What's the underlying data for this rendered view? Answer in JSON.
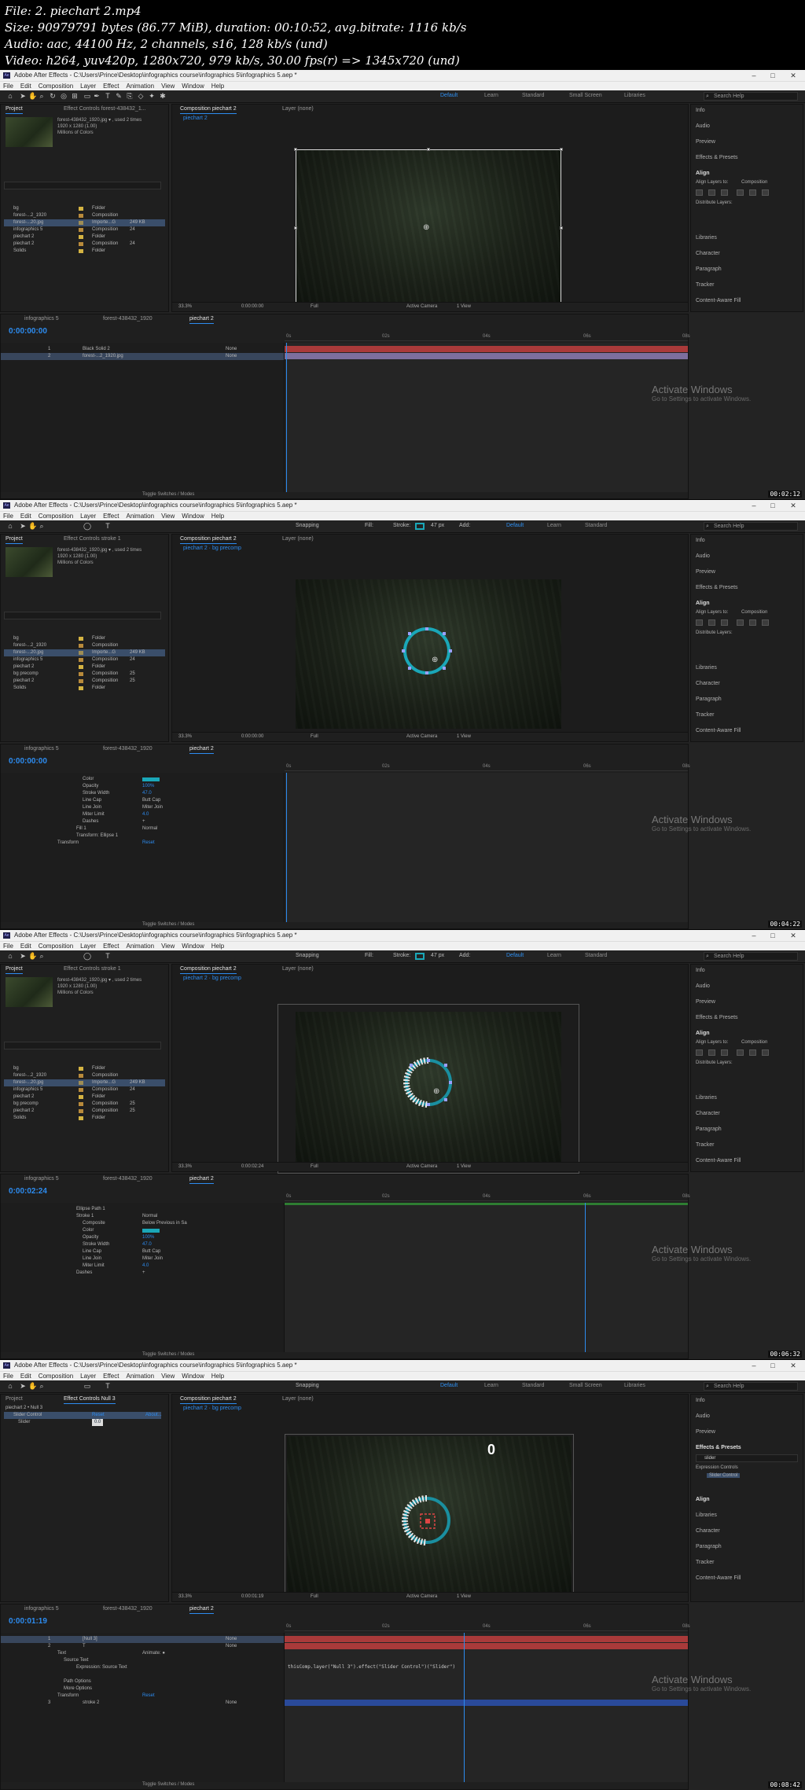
{
  "header": {
    "file": "File: 2. piechart 2.mp4",
    "size": "Size: 90979791 bytes (86.77 MiB), duration: 00:10:52, avg.bitrate: 1116 kb/s",
    "audio": "Audio: aac, 44100 Hz, 2 channels, s16, 128 kb/s (und)",
    "video": "Video: h264, yuv420p, 1280x720, 979 kb/s, 30.00 fps(r) => 1345x720 (und)"
  },
  "app": {
    "title_1": "Adobe After Effects - C:\\Users\\Prince\\Desktop\\infographics course\\infographics 5\\infographics 5.aep *",
    "menu": [
      "File",
      "Edit",
      "Composition",
      "Layer",
      "Effect",
      "Animation",
      "View",
      "Window",
      "Help"
    ],
    "workspaces": [
      "Default",
      "Learn",
      "Standard",
      "Small Screen",
      "Libraries"
    ],
    "search_placeholder": "Search Help",
    "snapping": "Snapping",
    "fill": "Fill:",
    "stroke": "Stroke:",
    "stroke_px": "47 px",
    "add": "Add:"
  },
  "frames": [
    {
      "project_tab": "Project",
      "effect_tab": "Effect Controls forest-438432_1...",
      "asset_name": "forest-438432_1920.jpg ▾ , used 2 times",
      "asset_dims": "1920 x 1280 (1.00)",
      "asset_colors": "Millions of Colors",
      "comp_tab": "Composition piechart 2",
      "comp_sub": "piechart 2",
      "layer_tab": "Layer (none)",
      "project_items": [
        {
          "name": "bg",
          "type": "Folder",
          "size": "",
          "color": "#d4b342"
        },
        {
          "name": "forest-...2_1920",
          "type": "Composition",
          "size": "",
          "color": "#b88a3b"
        },
        {
          "name": "forest-...20.jpg",
          "type": "Importe...G",
          "size": "249 KB",
          "color": "#9e8d55"
        },
        {
          "name": "infographics 5",
          "type": "Composition",
          "size": "24",
          "color": "#b88a3b"
        },
        {
          "name": "piechart 2",
          "type": "Folder",
          "size": "",
          "color": "#d4b342"
        },
        {
          "name": "piechart 2",
          "type": "Composition",
          "size": "24",
          "color": "#b88a3b"
        },
        {
          "name": "Solids",
          "type": "Folder",
          "size": "",
          "color": "#d4b342"
        }
      ],
      "zoom": "33.3%",
      "time": "0:00:00:00",
      "quality": "Full",
      "camera": "Active Camera",
      "views": "1 View",
      "tl_tabs": [
        "infographics 5",
        "forest-438432_1920",
        "piechart 2"
      ],
      "timecode": "0:00:00:00",
      "layers": [
        {
          "num": "1",
          "name": "Black Solid 2",
          "mode": "None"
        },
        {
          "num": "2",
          "name": "forest-...2_1920.jpg",
          "mode": "None"
        }
      ],
      "ruler": [
        "0s",
        "02s",
        "04s",
        "06s",
        "08s",
        "10s"
      ],
      "stamp": "00:02:12"
    },
    {
      "project_tab": "Project",
      "effect_tab": "Effect Controls stroke 1",
      "asset_name": "forest-438432_1920.jpg ▾ , used 2 times",
      "asset_dims": "1920 x 1280 (1.00)",
      "asset_colors": "Millions of Colors",
      "comp_tab": "Composition piechart 2",
      "comp_sub": "piechart 2 · bg precomp",
      "layer_tab": "Layer (none)",
      "project_items": [
        {
          "name": "bg",
          "type": "Folder",
          "size": "",
          "color": "#d4b342"
        },
        {
          "name": "forest-...2_1920",
          "type": "Composition",
          "size": "",
          "color": "#b88a3b"
        },
        {
          "name": "forest-...20.jpg",
          "type": "Importe...G",
          "size": "249 KB",
          "color": "#9e8d55"
        },
        {
          "name": "infographics 5",
          "type": "Composition",
          "size": "24",
          "color": "#b88a3b"
        },
        {
          "name": "piechart 2",
          "type": "Folder",
          "size": "",
          "color": "#d4b342"
        },
        {
          "name": "bg precomp",
          "type": "Composition",
          "size": "25",
          "color": "#b88a3b"
        },
        {
          "name": "piechart 2",
          "type": "Composition",
          "size": "25",
          "color": "#b88a3b"
        },
        {
          "name": "Solids",
          "type": "Folder",
          "size": "",
          "color": "#d4b342"
        }
      ],
      "zoom": "33.3%",
      "time": "0:00:00:00",
      "quality": "Full",
      "camera": "Active Camera",
      "views": "1 View",
      "tl_tabs": [
        "infographics 5",
        "forest-438432_1920",
        "piechart 2"
      ],
      "timecode": "0:00:00:00",
      "layers": [
        {
          "num": "",
          "name": "Color",
          "mode": ""
        },
        {
          "num": "",
          "name": "Opacity",
          "mode": "100%"
        },
        {
          "num": "",
          "name": "Stroke Width",
          "mode": "47.0"
        },
        {
          "num": "",
          "name": "Line Cap",
          "mode": "Butt Cap"
        },
        {
          "num": "",
          "name": "Line Join",
          "mode": "Miter Join"
        },
        {
          "num": "",
          "name": "Miter Limit",
          "mode": "4.0"
        },
        {
          "num": "",
          "name": "Dashes",
          "mode": "+"
        },
        {
          "num": "",
          "name": "Fill 1",
          "mode": "Normal"
        },
        {
          "num": "",
          "name": "Transform: Ellipse 1",
          "mode": ""
        },
        {
          "num": "",
          "name": "Transform",
          "mode": "Reset"
        }
      ],
      "ruler": [
        "0s",
        "02s",
        "04s",
        "06s",
        "08s",
        "10s"
      ],
      "stamp": "00:04:22"
    },
    {
      "project_tab": "Project",
      "effect_tab": "Effect Controls stroke 1",
      "asset_name": "forest-438432_1920.jpg ▾ , used 2 times",
      "asset_dims": "1920 x 1280 (1.00)",
      "asset_colors": "Millions of Colors",
      "comp_tab": "Composition piechart 2",
      "comp_sub": "piechart 2 · bg precomp",
      "layer_tab": "Layer (none)",
      "project_items": [
        {
          "name": "bg",
          "type": "Folder",
          "size": "",
          "color": "#d4b342"
        },
        {
          "name": "forest-...2_1920",
          "type": "Composition",
          "size": "",
          "color": "#b88a3b"
        },
        {
          "name": "forest-...20.jpg",
          "type": "Importe...G",
          "size": "249 KB",
          "color": "#9e8d55"
        },
        {
          "name": "infographics 5",
          "type": "Composition",
          "size": "24",
          "color": "#b88a3b"
        },
        {
          "name": "piechart 2",
          "type": "Folder",
          "size": "",
          "color": "#d4b342"
        },
        {
          "name": "bg precomp",
          "type": "Composition",
          "size": "25",
          "color": "#b88a3b"
        },
        {
          "name": "piechart 2",
          "type": "Composition",
          "size": "25",
          "color": "#b88a3b"
        },
        {
          "name": "Solids",
          "type": "Folder",
          "size": "",
          "color": "#d4b342"
        }
      ],
      "zoom": "33.3%",
      "time": "0:00:02:24",
      "quality": "Full",
      "camera": "Active Camera",
      "views": "1 View",
      "tl_tabs": [
        "infographics 5",
        "forest-438432_1920",
        "piechart 2"
      ],
      "timecode": "0:00:02:24",
      "layers": [
        {
          "num": "",
          "name": "Ellipse Path 1",
          "mode": ""
        },
        {
          "num": "",
          "name": "Stroke 1",
          "mode": "Normal"
        },
        {
          "num": "",
          "name": "Composite",
          "mode": "Below Previous in Sa"
        },
        {
          "num": "",
          "name": "Color",
          "mode": ""
        },
        {
          "num": "",
          "name": "Opacity",
          "mode": "100%"
        },
        {
          "num": "",
          "name": "Stroke Width",
          "mode": "47.0"
        },
        {
          "num": "",
          "name": "Line Cap",
          "mode": "Butt Cap"
        },
        {
          "num": "",
          "name": "Line Join",
          "mode": "Miter Join"
        },
        {
          "num": "",
          "name": "Miter Limit",
          "mode": "4.0"
        },
        {
          "num": "",
          "name": "Dashes",
          "mode": "+"
        }
      ],
      "ruler": [
        "0s",
        "02s",
        "04s",
        "06s",
        "08s",
        "10s"
      ],
      "stamp": "00:06:32"
    },
    {
      "project_tab": "Project",
      "effect_tab": "Effect Controls Null 3",
      "asset_name": "piechart 2 • Null 3",
      "asset_dims": "",
      "asset_colors": "",
      "comp_tab": "Composition piechart 2",
      "comp_sub": "piechart 2 · bg precomp",
      "layer_tab": "Layer (none)",
      "effect_items": [
        {
          "name": "Slider Control",
          "val": "Reset",
          "extra": "About..."
        },
        {
          "name": "Slider",
          "val": "0.0",
          "extra": ""
        }
      ],
      "project_items": [],
      "zoom": "33.3%",
      "time": "0:00:01:19",
      "quality": "Full",
      "camera": "Active Camera",
      "views": "1 View",
      "tl_tabs": [
        "infographics 5",
        "forest-438432_1920",
        "piechart 2"
      ],
      "timecode": "0:00:01:19",
      "layers": [
        {
          "num": "1",
          "name": "[Null 3]",
          "mode": "None"
        },
        {
          "num": "2",
          "name": "T",
          "mode": "None"
        },
        {
          "num": "",
          "name": "Text",
          "mode": "Animate: ●"
        },
        {
          "num": "",
          "name": "Source Text",
          "mode": ""
        },
        {
          "num": "",
          "name": "Expression: Source Text",
          "mode": ""
        },
        {
          "num": "",
          "name": "Path Options",
          "mode": ""
        },
        {
          "num": "",
          "name": "More Options",
          "mode": ""
        },
        {
          "num": "",
          "name": "Transform",
          "mode": "Reset"
        },
        {
          "num": "3",
          "name": "stroke 2",
          "mode": "None"
        }
      ],
      "expression": "thisComp.layer(\"Null 3\").effect(\"Slider Control\")(\"Slider\")",
      "slider_value": "0",
      "effects_search": "slider",
      "effects_group": "Expression Controls",
      "effects_item": "Slider Control",
      "ruler": [
        "0s",
        "02s",
        "04s",
        "06s",
        "08s",
        "10s"
      ],
      "stamp": "00:08:42"
    }
  ],
  "right_panel": [
    "Info",
    "Audio",
    "Preview",
    "Effects & Presets",
    "Align",
    "Align Layers to:",
    "Composition",
    "Distribute Layers:",
    "Libraries",
    "Character",
    "Paragraph",
    "Tracker",
    "Content-Aware Fill"
  ],
  "right_panel_4": [
    "Info",
    "Audio",
    "Preview",
    "Effects & Presets",
    "Align",
    "Libraries",
    "Character",
    "Paragraph",
    "Tracker",
    "Content-Aware Fill"
  ],
  "watermark": {
    "title": "Activate Windows",
    "sub": "Go to Settings to activate Windows."
  },
  "toggle": "Toggle Switches / Modes",
  "colors": {
    "accent": "#2d8cf0",
    "ring": "#1aa7b8",
    "red_track": "#a93a3a",
    "green_bar": "#2e7d32",
    "purple_track": "#7d6f9e"
  }
}
